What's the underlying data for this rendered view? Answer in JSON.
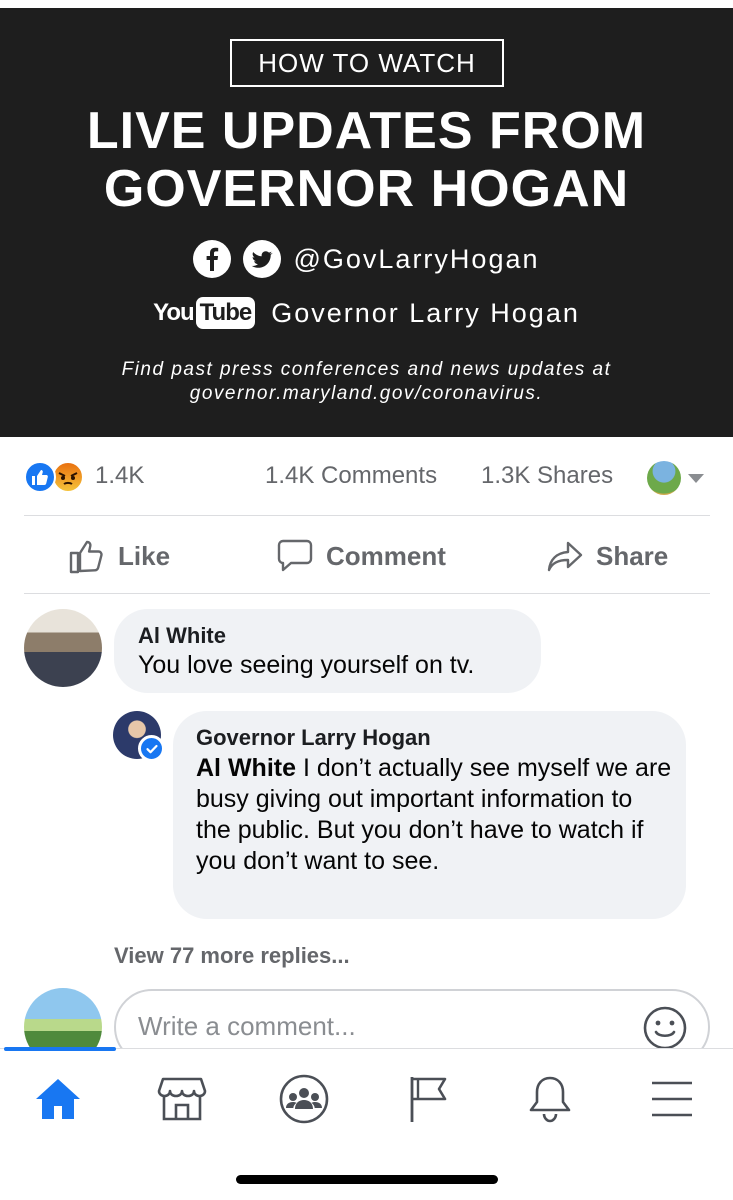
{
  "banner": {
    "badge": "HOW TO WATCH",
    "headline_line1": "LIVE UPDATES FROM",
    "headline_line2": "GOVERNOR HOGAN",
    "social_handle": "@GovLarryHogan",
    "youtube_word1": "You",
    "youtube_word2": "Tube",
    "youtube_channel": "Governor Larry Hogan",
    "footer_line1": "Find past press conferences and news updates at",
    "footer_line2": "governor.maryland.gov/coronavirus."
  },
  "stats": {
    "reaction_count": "1.4K",
    "comments": "1.4K Comments",
    "shares": "1.3K Shares",
    "reactions": [
      "like-icon",
      "angry-icon"
    ]
  },
  "actions": {
    "like": "Like",
    "comment": "Comment",
    "share": "Share"
  },
  "comments": [
    {
      "author": "Al White",
      "text": "You love seeing yourself on tv."
    },
    {
      "author": "Governor Larry Hogan",
      "verified": true,
      "mention": "Al White",
      "text": " I don’t actually see myself we are busy giving out important information to the public. But you don’t have to watch if you don’t want to see."
    }
  ],
  "more_replies": "View 77 more replies...",
  "composer": {
    "placeholder": "Write a comment..."
  },
  "tabbar": {
    "tabs": [
      "home-icon",
      "marketplace-icon",
      "groups-icon",
      "pages-flag-icon",
      "notifications-bell-icon",
      "menu-icon"
    ],
    "active": "home-icon"
  },
  "colors": {
    "brand_blue": "#1877f2",
    "banner_bg": "#1e1e1e",
    "bubble_bg": "#f0f2f5",
    "secondary_text": "#65676b"
  }
}
